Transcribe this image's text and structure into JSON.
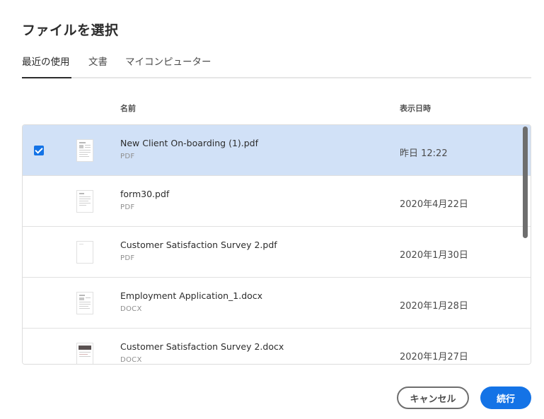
{
  "dialog": {
    "title": "ファイルを選択"
  },
  "tabs": [
    {
      "label": "最近の使用",
      "active": true
    },
    {
      "label": "文書",
      "active": false
    },
    {
      "label": "マイコンピューター",
      "active": false
    }
  ],
  "columns": {
    "name": "名前",
    "date": "表示日時"
  },
  "files": [
    {
      "name": "New Client On-boarding (1).pdf",
      "type": "PDF",
      "date": "昨日 12:22",
      "selected": true,
      "thumb": "form-icon"
    },
    {
      "name": "form30.pdf",
      "type": "PDF",
      "date": "2020年4月22日",
      "selected": false,
      "thumb": "form-icon"
    },
    {
      "name": "Customer Satisfaction Survey 2.pdf",
      "type": "PDF",
      "date": "2020年1月30日",
      "selected": false,
      "thumb": "blank-page-icon"
    },
    {
      "name": "Employment Application_1.docx",
      "type": "DOCX",
      "date": "2020年1月28日",
      "selected": false,
      "thumb": "form-icon"
    },
    {
      "name": "Customer Satisfaction Survey 2.docx",
      "type": "DOCX",
      "date": "2020年1月27日",
      "selected": false,
      "thumb": "survey-page-icon"
    }
  ],
  "footer": {
    "cancel_label": "キャンセル",
    "continue_label": "続行"
  },
  "colors": {
    "accent": "#1473e6",
    "selected_row": "#d1e1f7"
  }
}
